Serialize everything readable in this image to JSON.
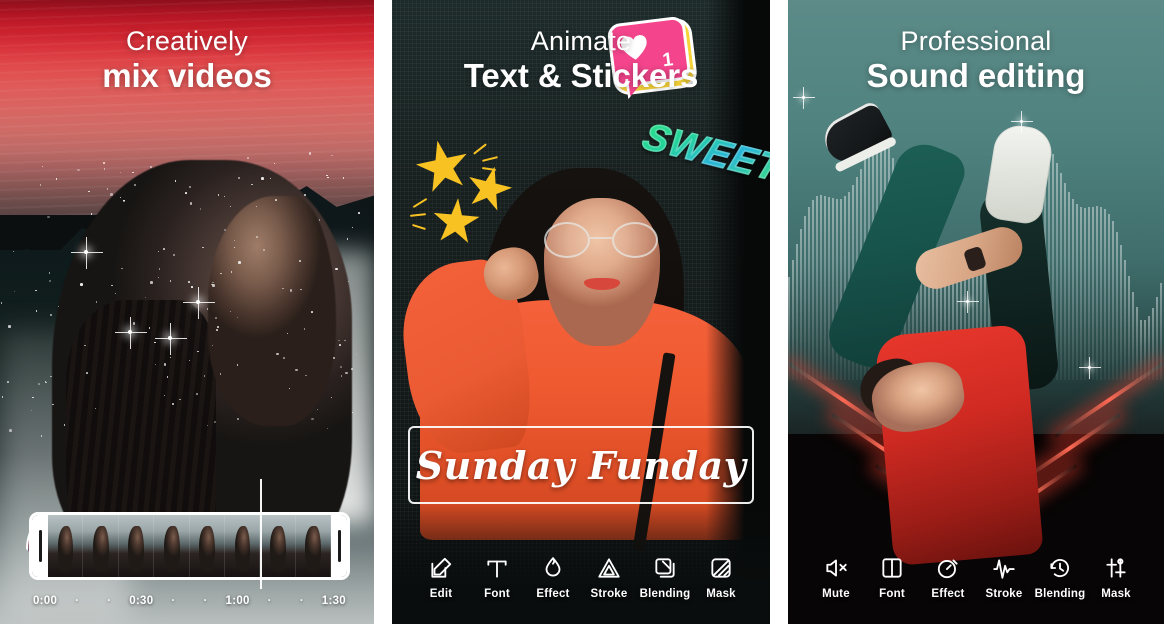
{
  "panels": [
    {
      "heading": {
        "line1": "Creatively",
        "line2": "mix videos"
      },
      "timeline": {
        "times": [
          "0:00",
          "0:30",
          "1:00",
          "1:30"
        ],
        "separator": "·",
        "pins": [
          {
            "name": "clip-thumb-sunset"
          },
          {
            "name": "clip-thumb-stars"
          }
        ]
      },
      "toolbar": []
    },
    {
      "heading": {
        "line1": "Animate",
        "line2": "Text & Stickers"
      },
      "stickers": {
        "like_badge": {
          "count": "1",
          "heart": "heart-icon",
          "color": "#f4458c",
          "shadow_color": "#f7d33a"
        },
        "sweet_text": "SWEET",
        "stars_color": "#f9c223"
      },
      "caption": "Sunday Funday",
      "toolbar": [
        {
          "label": "Edit",
          "icon": "pencil-square-icon"
        },
        {
          "label": "Font",
          "icon": "font-t-icon"
        },
        {
          "label": "Effect",
          "icon": "droplet-icon"
        },
        {
          "label": "Stroke",
          "icon": "triangle-icon"
        },
        {
          "label": "Blending",
          "icon": "layers-square-icon"
        },
        {
          "label": "Mask",
          "icon": "mask-square-icon"
        }
      ]
    },
    {
      "heading": {
        "line1": "Professional",
        "line2": "Sound editing"
      },
      "toolbar": [
        {
          "label": "Mute",
          "icon": "speaker-mute-icon"
        },
        {
          "label": "Font",
          "icon": "split-rectangle-icon"
        },
        {
          "label": "Effect",
          "icon": "stopwatch-icon"
        },
        {
          "label": "Stroke",
          "icon": "waveform-icon"
        },
        {
          "label": "Blending",
          "icon": "clock-rotate-icon"
        },
        {
          "label": "Mask",
          "icon": "sliders-icon"
        }
      ]
    }
  ],
  "colors": {
    "accent_pink": "#f4458c",
    "accent_yellow": "#f9c223",
    "accent_orange": "#ef5a31",
    "accent_teal": "#2fe08a",
    "panel1_sky": "#d8333c",
    "panel3_bg": "#4f827f",
    "neon_red": "#ff6a55"
  }
}
